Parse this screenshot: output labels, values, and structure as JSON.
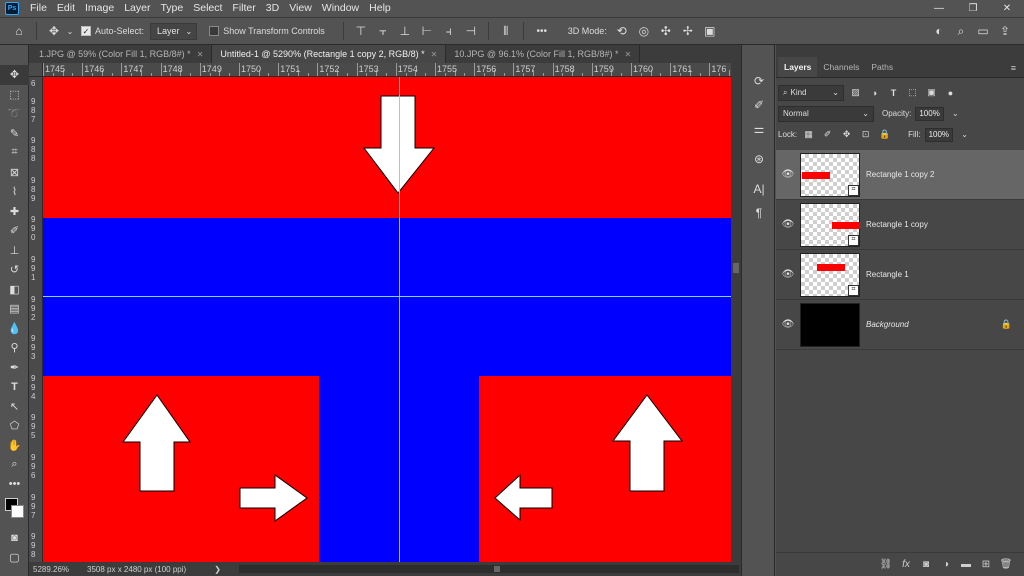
{
  "menu": [
    "File",
    "Edit",
    "Image",
    "Layer",
    "Type",
    "Select",
    "Filter",
    "3D",
    "View",
    "Window",
    "Help"
  ],
  "app_logo": "Ps",
  "window_controls": {
    "minimize": "—",
    "maximize": "❐",
    "close": "✕"
  },
  "options": {
    "auto_select_label": "Auto-Select:",
    "auto_select_checked": true,
    "auto_select_target": "Layer",
    "show_transform_label": "Show Transform Controls",
    "more": "•••",
    "mode_3d_label": "3D Mode:"
  },
  "tabs": [
    {
      "label": "1.JPG @ 59% (Color Fill 1, RGB/8#) *",
      "active": false
    },
    {
      "label": "Untitled-1 @ 5290% (Rectangle 1 copy 2, RGB/8) *",
      "active": true
    },
    {
      "label": "10.JPG @ 96.1% (Color Fill 1, RGB/8#) *",
      "active": false
    }
  ],
  "ruler_h": [
    "1745",
    "1746",
    "1747",
    "1748",
    "1749",
    "1750",
    "1751",
    "1752",
    "1753",
    "1754",
    "1755",
    "1756",
    "1757",
    "1758",
    "1759",
    "1760",
    "1761",
    "176"
  ],
  "ruler_v": [
    "6",
    "9\n8\n7",
    "9\n8\n8",
    "9\n8\n9",
    "9\n9\n0",
    "9\n9\n1",
    "9\n9\n2",
    "9\n9\n3",
    "9\n9\n4",
    "9\n9\n5",
    "9\n9\n6",
    "9\n9\n7",
    "9\n9\n8"
  ],
  "status": {
    "zoom": "5289.26%",
    "doc_size": "3508 px x 2480 px (100 ppi)",
    "arrow": "❯"
  },
  "canvas_colors": {
    "red": "#ff0000",
    "blue": "#0000ff",
    "guide": "#7fd8e6",
    "arrow": "#ffffff"
  },
  "panel": {
    "tabs": [
      {
        "label": "Layers",
        "active": true
      },
      {
        "label": "Channels",
        "active": false
      },
      {
        "label": "Paths",
        "active": false
      }
    ],
    "menu_icon": "≡",
    "filter_kind": "Kind",
    "blend_mode": "Normal",
    "opacity_label": "Opacity:",
    "opacity_value": "100%",
    "lock_label": "Lock:",
    "fill_label": "Fill:",
    "fill_value": "100%",
    "layers": [
      {
        "name": "Rectangle 1 copy 2",
        "selected": true,
        "visible": true,
        "italic": false,
        "locked": false
      },
      {
        "name": "Rectangle 1 copy",
        "selected": false,
        "visible": true,
        "italic": false,
        "locked": false
      },
      {
        "name": "Rectangle 1",
        "selected": false,
        "visible": true,
        "italic": false,
        "locked": false
      },
      {
        "name": "Background",
        "selected": false,
        "visible": true,
        "italic": true,
        "locked": true
      }
    ],
    "footer_icons": [
      "link-icon",
      "fx-icon",
      "mask-icon",
      "adjustment-icon",
      "group-folder-icon",
      "new-layer-icon",
      "trash-icon"
    ]
  }
}
